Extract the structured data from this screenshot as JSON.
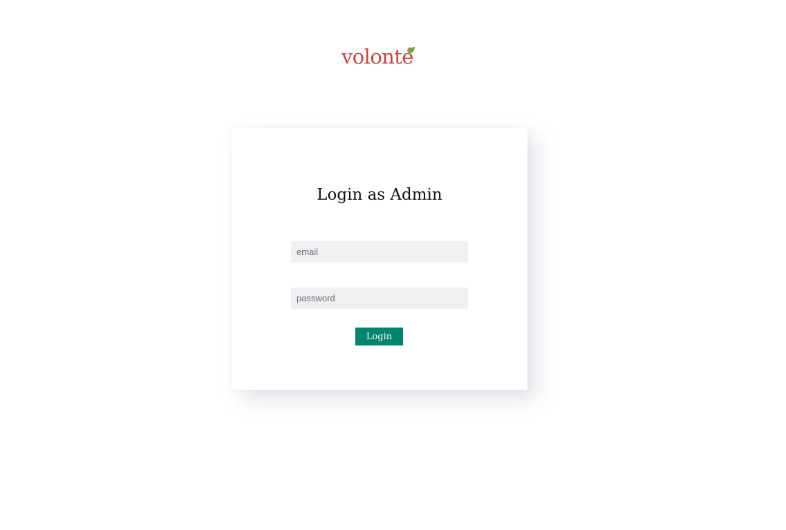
{
  "logo": {
    "text": "volonté",
    "text_color": "#d1413a",
    "leaf_color": "#6aab3a"
  },
  "login_card": {
    "title": "Login as Admin",
    "email_placeholder": "email",
    "email_value": "",
    "password_placeholder": "password",
    "password_value": "",
    "login_label": "Login",
    "button_color": "#00856a"
  }
}
